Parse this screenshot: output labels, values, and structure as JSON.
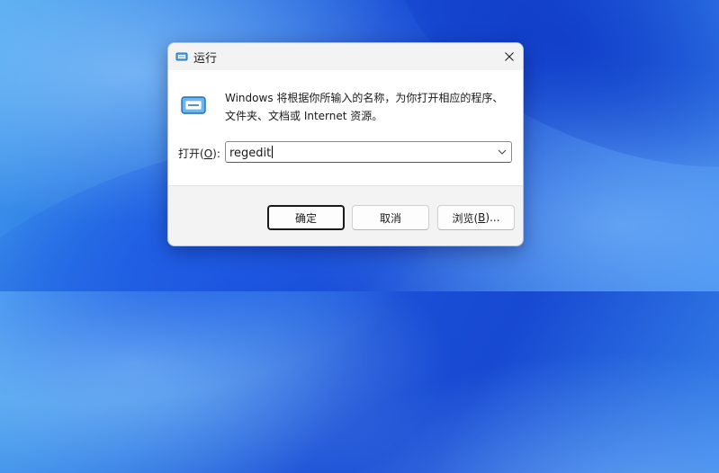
{
  "dialog": {
    "title": "运行",
    "icons": {
      "title": "run-icon",
      "close": "close-icon",
      "main": "run-icon",
      "dropdown": "chevron-down-icon"
    },
    "description_line1": "Windows 将根据你所输入的名称，为你打开相应的程序、",
    "description_line2": "文件夹、文档或 Internet 资源。",
    "open_label_prefix": "打开(",
    "open_label_key": "O",
    "open_label_suffix": "):",
    "input_value": "regedit",
    "buttons": {
      "ok": "确定",
      "cancel": "取消",
      "browse_prefix": "浏览(",
      "browse_key": "B",
      "browse_suffix": ")..."
    }
  },
  "colors": {
    "accent": "#0067c0",
    "dialog_bg": "#f3f3f3",
    "content_bg": "#ffffff"
  }
}
